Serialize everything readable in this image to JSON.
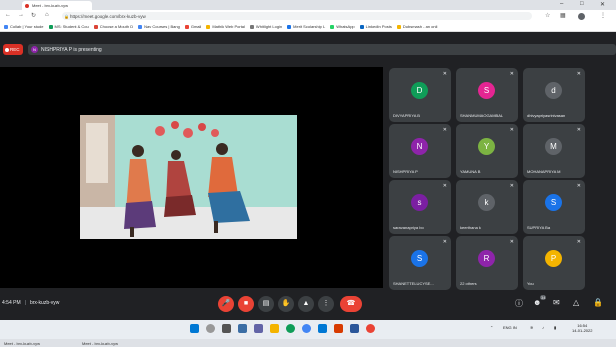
{
  "browser": {
    "tab_title": "Meet - brx-kuzb-vyw",
    "url": "https://meet.google.com/brx-kuzb-vyw",
    "bookmarks": [
      {
        "label": "Collab | Your stude",
        "color": "#4285f4"
      },
      {
        "label": "MS: Student & Cou",
        "color": "#0f9d58"
      },
      {
        "label": "Choose a Mouth D",
        "color": "#db4437"
      },
      {
        "label": "Nav Courses | Bang",
        "color": "#4285f4"
      },
      {
        "label": "Gmail",
        "color": "#ea4335"
      },
      {
        "label": "Mathik Web Portal",
        "color": "#f4b400"
      },
      {
        "label": "Whitlight Login",
        "color": "#777777"
      },
      {
        "label": "Merit Scolarship L",
        "color": "#1a73e8"
      },
      {
        "label": "WhatsApp",
        "color": "#25d366"
      },
      {
        "label": "LinkedIn Posts",
        "color": "#0a66c2"
      },
      {
        "label": "Dubsmash - an onli",
        "color": "#f4b400"
      }
    ]
  },
  "meet": {
    "rec_label": "REC",
    "presenting_text": "NISHPRIYA P is presenting",
    "presenter_initial": "N",
    "participants": [
      {
        "name": "DIVYAPRIYA B",
        "initial": "D",
        "color": "#0f9d58"
      },
      {
        "name": "SHANMUMAOGAMBAL",
        "initial": "S",
        "color": "#e52592"
      },
      {
        "name": "dhivyapriyasrinivasan",
        "initial": "d",
        "color": "#5f6368"
      },
      {
        "name": "NISHPRIYA P",
        "initial": "N",
        "color": "#8e24aa"
      },
      {
        "name": "YAMUNA B",
        "initial": "Y",
        "color": "#7cb342"
      },
      {
        "name": "MOHANAPRIYA M",
        "initial": "M",
        "color": "#5f6368"
      },
      {
        "name": "saravanapriya bo",
        "initial": "s",
        "color": "#7b1fa2"
      },
      {
        "name": "keerthana k",
        "initial": "k",
        "color": "#5f6368"
      },
      {
        "name": "SUPRIYA Ba",
        "initial": "S",
        "color": "#1a73e8"
      },
      {
        "name": "SHANETTELUCYSE...",
        "initial": "S",
        "color": "#1a73e8"
      },
      {
        "name": "22 others",
        "initial": "R",
        "color": "#8e24aa"
      },
      {
        "name": "You",
        "initial": "P",
        "color": "#f4b400"
      }
    ],
    "time": "4:54 PM",
    "meeting_code": "brx-kuzb-vyw",
    "participant_count": "34"
  },
  "taskbar": {
    "time": "16:54",
    "date": "14-01-2022",
    "lang": "ENG IN"
  }
}
